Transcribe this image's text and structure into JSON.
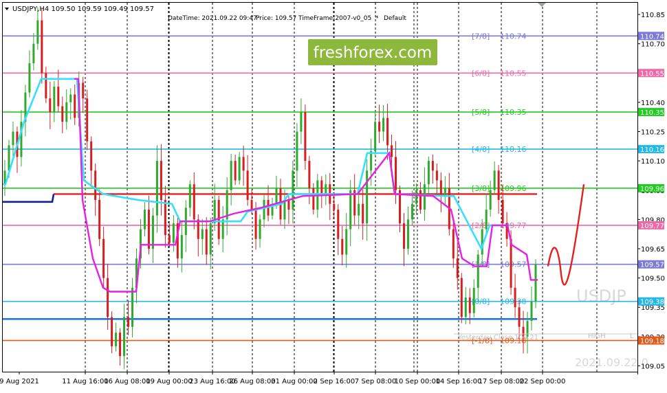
{
  "header": {
    "symbol_info": "USDJPY,H4  109.50 109.59 109.49 109.57",
    "datetime_info": "DateTime: 2021.09.22 09:47",
    "price_info": "Price: 109.57",
    "timeframe_info": "TimeFrame-2007-v0_05",
    "asterisk": "*",
    "default_info": "Default"
  },
  "watermark": {
    "brand": "freshforex.com",
    "brand_bg": "#8db83b",
    "symbol": "USDJP",
    "datetime": "2021.09.22 0"
  },
  "murrey_levels": [
    {
      "label": "[7/8]",
      "value_text": "110.74",
      "price": 110.74,
      "color": "#7b7bd6"
    },
    {
      "label": "[6/8]",
      "value_text": "110.55",
      "price": 110.55,
      "color": "#ee6aa7"
    },
    {
      "label": "[5/8]",
      "value_text": "110.35",
      "price": 110.35,
      "color": "#22cc22"
    },
    {
      "label": "[4/8]",
      "value_text": "110.16",
      "price": 110.16,
      "color": "#22b8e8"
    },
    {
      "label": "[3/8]",
      "value_text": "109.96",
      "price": 109.96,
      "color": "#22cc22"
    },
    {
      "label": "[2/8]",
      "value_text": "109.77",
      "price": 109.77,
      "color": "#ee6aa7"
    },
    {
      "label": "[1/8]",
      "value_text": "109.57",
      "price": 109.57,
      "color": "#7b7bd6"
    },
    {
      "label": "[0/8]",
      "value_text": "109.38",
      "price": 109.38,
      "color": "#22b8e8"
    },
    {
      "label": "[-1/8]",
      "value_text": "109.18",
      "price": 109.18,
      "color": "#e05a1a"
    }
  ],
  "extra_lines": [
    {
      "name": "blue-level",
      "price": 109.29,
      "color": "#1e78e6"
    },
    {
      "name": "red-level",
      "price": 109.93,
      "color": "#e61e1e"
    }
  ],
  "close_labels": {
    "yesterday_close": "Yesterday Close 109.21",
    "high": "HIGH",
    "low_tag": "L"
  },
  "price_axis": {
    "ticks": [
      "110.85",
      "110.70",
      "110.55",
      "110.40",
      "110.25",
      "110.10",
      "109.95",
      "109.80",
      "109.65",
      "109.50",
      "109.35",
      "109.20",
      "109.05"
    ],
    "highlight_labels": [
      {
        "text": "110.74",
        "price": 110.74,
        "bg": "#7b7bd6"
      },
      {
        "text": "110.55",
        "price": 110.55,
        "bg": "#ee6aa7"
      },
      {
        "text": "110.35",
        "price": 110.35,
        "bg": "#22cc22"
      },
      {
        "text": "110.16",
        "price": 110.16,
        "bg": "#22b8e8"
      },
      {
        "text": "109.96",
        "price": 109.96,
        "bg": "#22cc22"
      },
      {
        "text": "109.77",
        "price": 109.77,
        "bg": "#ee6aa7"
      },
      {
        "text": "109.57",
        "price": 109.57,
        "bg": "#7b7bd6"
      },
      {
        "text": "109.38",
        "price": 109.38,
        "bg": "#22b8e8"
      },
      {
        "text": "109.18",
        "price": 109.18,
        "bg": "#e05a1a"
      }
    ]
  },
  "time_axis": {
    "labels": [
      "9 Aug 2021",
      "11 Aug 16:00",
      "16 Aug 08:00",
      "19 Aug 00:00",
      "23 Aug 16:00",
      "26 Aug 08:00",
      "31 Aug 00:00",
      "2 Sep 16:00",
      "7 Sep 08:00",
      "10 Sep 00:00",
      "14 Sep 16:00",
      "17 Sep 08:00",
      "22 Sep 00:00"
    ]
  },
  "colors": {
    "bull": "#2eaa2e",
    "bear": "#d61e1e",
    "cyan_line": "#33e0ff",
    "magenta_line": "#e61ee6",
    "navy_line": "#1020a0",
    "forecast": "#e61e1e"
  },
  "chart_data": {
    "type": "candlestick",
    "symbol": "USDJPY",
    "timeframe": "H4",
    "last_bar": {
      "open": 109.5,
      "high": 109.59,
      "low": 109.49,
      "close": 109.57
    },
    "y_range": [
      109.02,
      110.91
    ],
    "closes": [
      110.05,
      110.18,
      110.25,
      110.12,
      110.3,
      110.45,
      110.6,
      110.7,
      110.82,
      110.55,
      110.42,
      110.35,
      110.48,
      110.38,
      110.3,
      110.4,
      110.44,
      110.32,
      110.5,
      110.42,
      110.2,
      110.05,
      109.9,
      109.7,
      109.5,
      109.3,
      109.15,
      109.22,
      109.1,
      109.3,
      109.25,
      109.45,
      109.6,
      109.75,
      109.85,
      109.65,
      109.82,
      110.1,
      109.9,
      109.72,
      109.68,
      109.78,
      109.6,
      109.72,
      109.86,
      109.98,
      109.8,
      109.7,
      109.75,
      109.62,
      109.78,
      109.9,
      109.7,
      109.8,
      109.95,
      110.1,
      110.0,
      110.12,
      110.05,
      109.9,
      109.85,
      109.7,
      109.8,
      109.9,
      109.82,
      109.88,
      109.96,
      109.8,
      109.9,
      109.85,
      110.05,
      110.25,
      110.35,
      110.1,
      109.96,
      109.85,
      110.0,
      109.92,
      109.98,
      109.88,
      109.85,
      109.7,
      109.62,
      109.75,
      109.95,
      109.82,
      109.88,
      109.78,
      110.05,
      110.15,
      110.3,
      110.25,
      110.32,
      110.18,
      110.12,
      109.95,
      109.78,
      109.65,
      109.8,
      109.88,
      109.95,
      109.85,
      109.98,
      110.1,
      110.05,
      110.0,
      109.92,
      109.96,
      109.75,
      109.6,
      109.5,
      109.3,
      109.4,
      109.32,
      109.45,
      109.62,
      109.75,
      109.85,
      109.95,
      110.05,
      109.9,
      109.78,
      109.7,
      109.45,
      109.35,
      109.25,
      109.2,
      109.28,
      109.38,
      109.57
    ]
  }
}
